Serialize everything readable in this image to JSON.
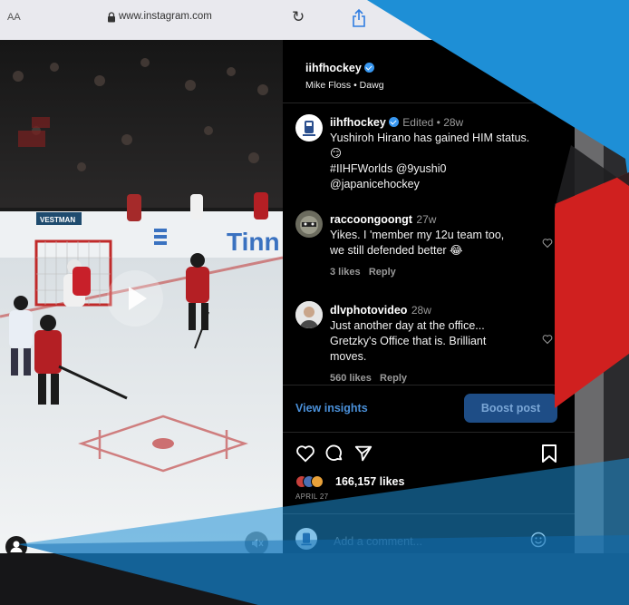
{
  "browser": {
    "text_size_label": "AA",
    "url": "www.instagram.com"
  },
  "post": {
    "username": "iihfhockey",
    "audio": "Mike Floss • Dawg",
    "caption": {
      "username": "iihfhockey",
      "edited": "Edited",
      "time": "28w",
      "lines": [
        "Yushiroh Hirano has gained HIM status.",
        "😏",
        "#IIHFWorlds @9yushi0",
        "@japanicehockey"
      ]
    },
    "comments": [
      {
        "username": "raccoongoongt",
        "time": "27w",
        "lines": [
          "Yikes. I 'member my 12u team too,",
          "we still defended better 😂"
        ],
        "likes": "3 likes",
        "reply": "Reply"
      },
      {
        "username": "dlvphotovideo",
        "time": "28w",
        "lines": [
          "Just another day at the office...",
          "Gretzky's Office that is. Brilliant",
          "moves."
        ],
        "likes": "560 likes",
        "reply": "Reply"
      }
    ],
    "view_insights": "View insights",
    "boost_post": "Boost post",
    "likes_count": "166,157 likes",
    "date": "APRIL 27",
    "comment_placeholder": "Add a comment..."
  },
  "video": {
    "rink_ad": "Tinn",
    "board_ad": "VESTMAN"
  },
  "colors": {
    "accent_blue": "#3897f0",
    "overlay_blue": "#1e8fd6",
    "overlay_red": "#d0201f"
  },
  "icons": [
    "lock-icon",
    "reload-icon",
    "share-icon",
    "verified-icon",
    "heart-icon",
    "comment-icon",
    "send-icon",
    "bookmark-icon",
    "play-icon",
    "mute-icon",
    "user-icon",
    "emoji-icon"
  ]
}
